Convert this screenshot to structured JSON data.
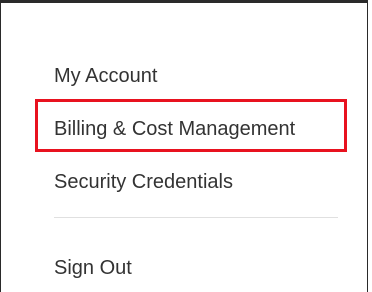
{
  "menu": {
    "items": [
      {
        "label": "My Account"
      },
      {
        "label": "Billing & Cost Management"
      },
      {
        "label": "Security Credentials"
      },
      {
        "label": "Sign Out"
      }
    ]
  },
  "colors": {
    "text": "#333333",
    "highlight": "#e8121f",
    "divider": "#e0e0e0",
    "frame": "#2a2a2a"
  }
}
